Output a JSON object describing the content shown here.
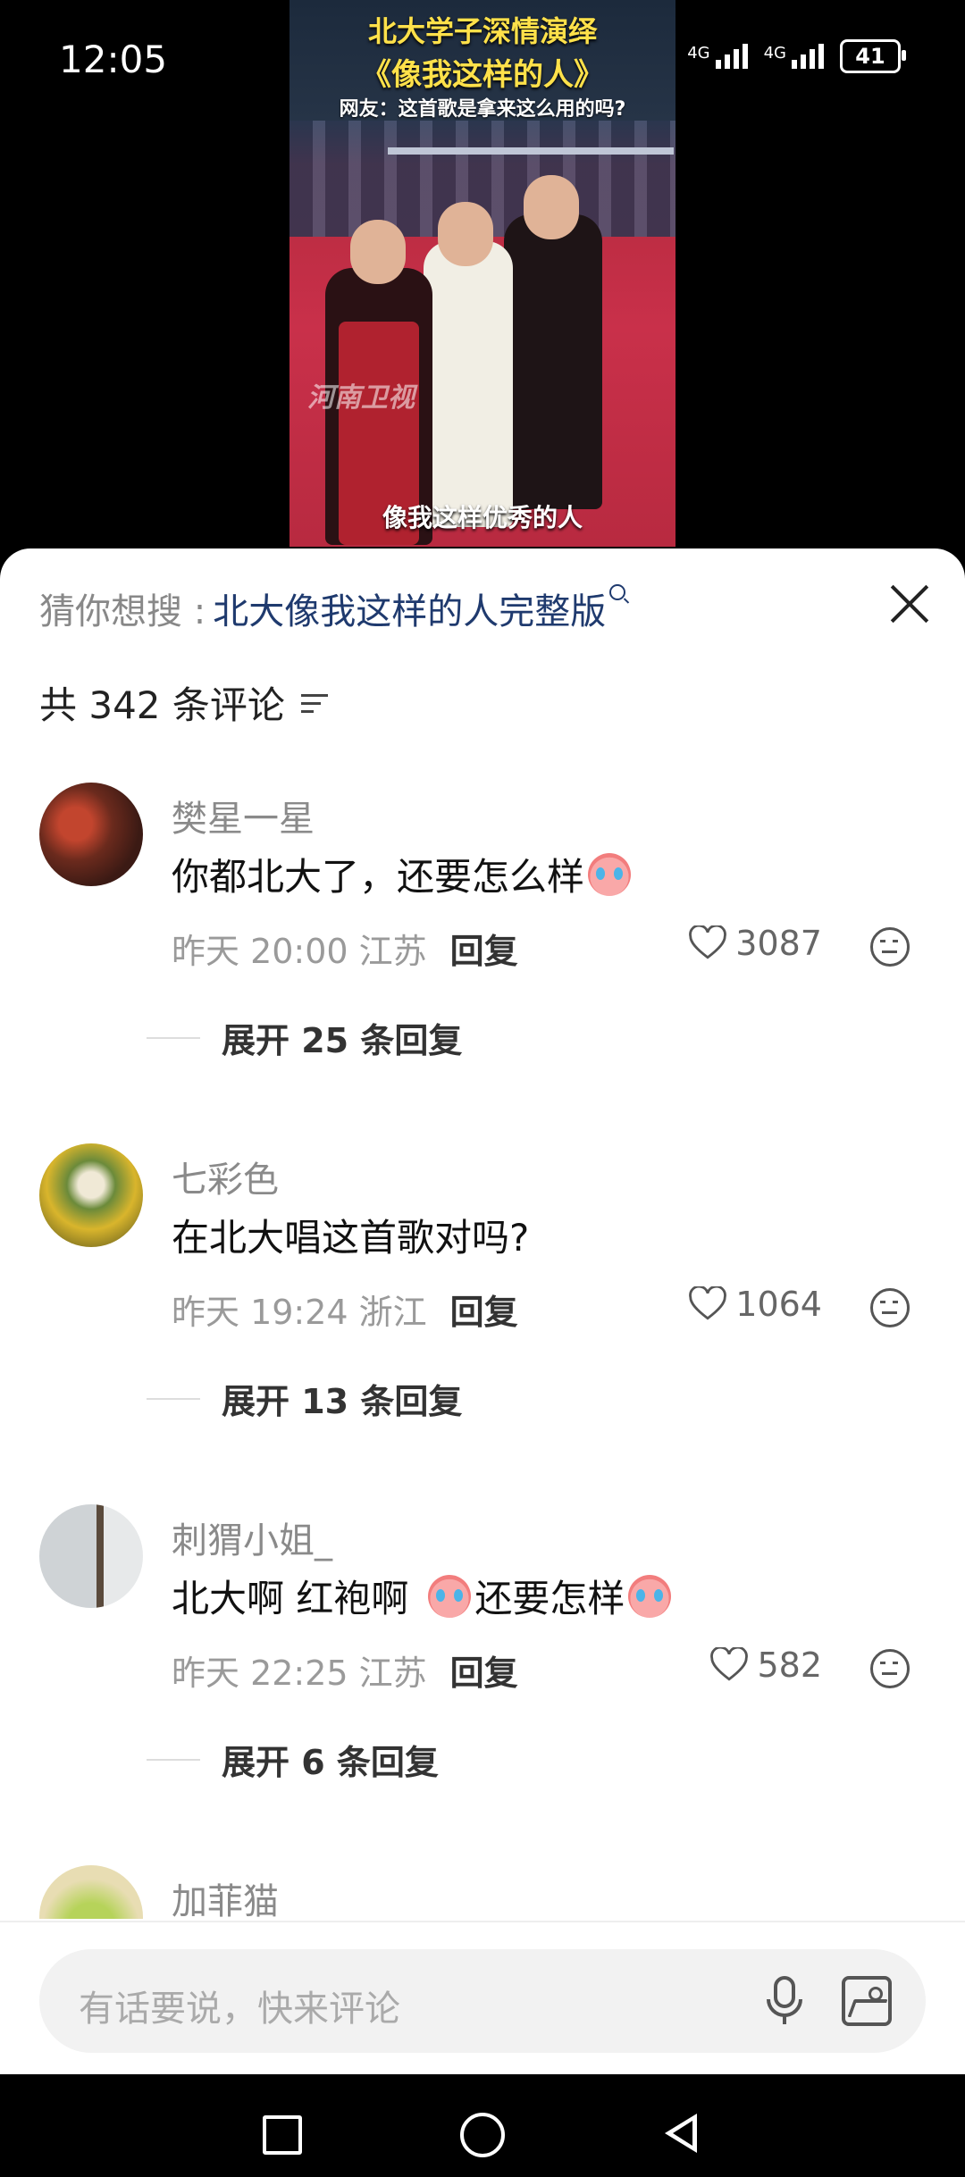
{
  "status": {
    "time": "12:05",
    "net1": "4G",
    "net2": "4G",
    "battery": "41"
  },
  "video": {
    "title_line1": "北大学子深情演绎",
    "title_line2": "《像我这样的人》",
    "subtitle": "网友：这首歌是拿来这么用的吗?",
    "watermark": "河南卫视",
    "caption": "像我这样优秀的人"
  },
  "panel": {
    "suggest_prefix": "猜你想搜 :",
    "suggest_query": "北大像我这样的人完整版",
    "comment_count": "共 342 条评论"
  },
  "comments": [
    {
      "user": "樊星一星",
      "text": "你都北大了，还要怎么样",
      "time": "昨天 20:00 江苏",
      "reply": "回复",
      "likes": "3087",
      "expand": "展开 25 条回复"
    },
    {
      "user": "七彩色",
      "text": "在北大唱这首歌对吗?",
      "time": "昨天 19:24 浙江",
      "reply": "回复",
      "likes": "1064",
      "expand": "展开 13 条回复"
    },
    {
      "user": "刺猬小姐_",
      "text_a": "北大啊  红袍啊",
      "text_b": "还要怎样",
      "time": "昨天 22:25 江苏",
      "reply": "回复",
      "likes": "582",
      "expand": "展开 6 条回复"
    },
    {
      "user": "加菲猫"
    }
  ],
  "input": {
    "placeholder": "有话要说，快来评论"
  }
}
